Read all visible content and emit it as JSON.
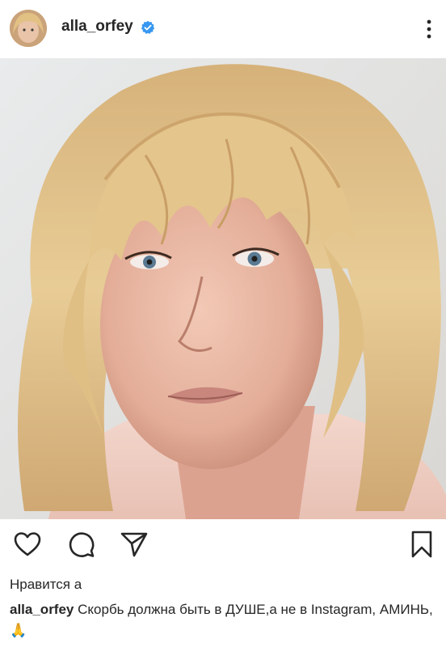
{
  "post": {
    "username": "alla_orfey",
    "verified": true,
    "likes_text": "Нравится а",
    "caption_user": "alla_orfey",
    "caption_text": "Скорбь должна быть в ДУШЕ,а не в Instagram,  АМИНЬ,🙏"
  },
  "icons": {
    "more": "more-options-icon",
    "like": "heart-icon",
    "comment": "comment-icon",
    "share": "send-icon",
    "save": "bookmark-icon"
  },
  "colors": {
    "text": "#262626",
    "verified": "#3897f0",
    "background": "#ffffff"
  }
}
